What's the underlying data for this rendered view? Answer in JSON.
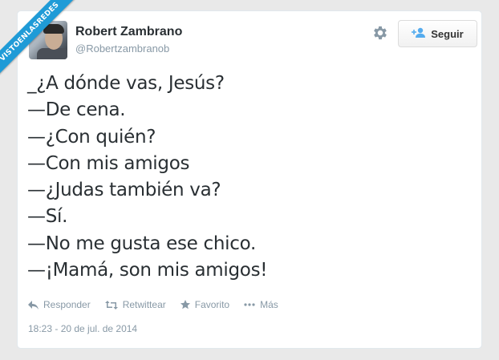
{
  "watermark": "VISTOENLASREDES",
  "author": {
    "name": "Robert Zambrano",
    "handle": "@Robertzambranob"
  },
  "header": {
    "follow_label": "Seguir",
    "settings_icon": "gear-icon",
    "follow_icon": "add-user-icon"
  },
  "tweet": {
    "lines": [
      "_¿A dónde vas, Jesús?",
      "—De cena.",
      "—¿Con quién?",
      "—Con mis amigos",
      "—¿Judas también va?",
      "—Sí.",
      "—No me gusta ese chico.",
      "—¡Mamá, son mis amigos!"
    ]
  },
  "actions": {
    "reply": "Responder",
    "retweet": "Retwittear",
    "favorite": "Favorito",
    "more": "Más"
  },
  "timestamp": "18:23 - 20 de jul. de 2014",
  "colors": {
    "brand_blue": "#1f9bd7",
    "text": "#292f33",
    "muted": "#8899a6"
  }
}
